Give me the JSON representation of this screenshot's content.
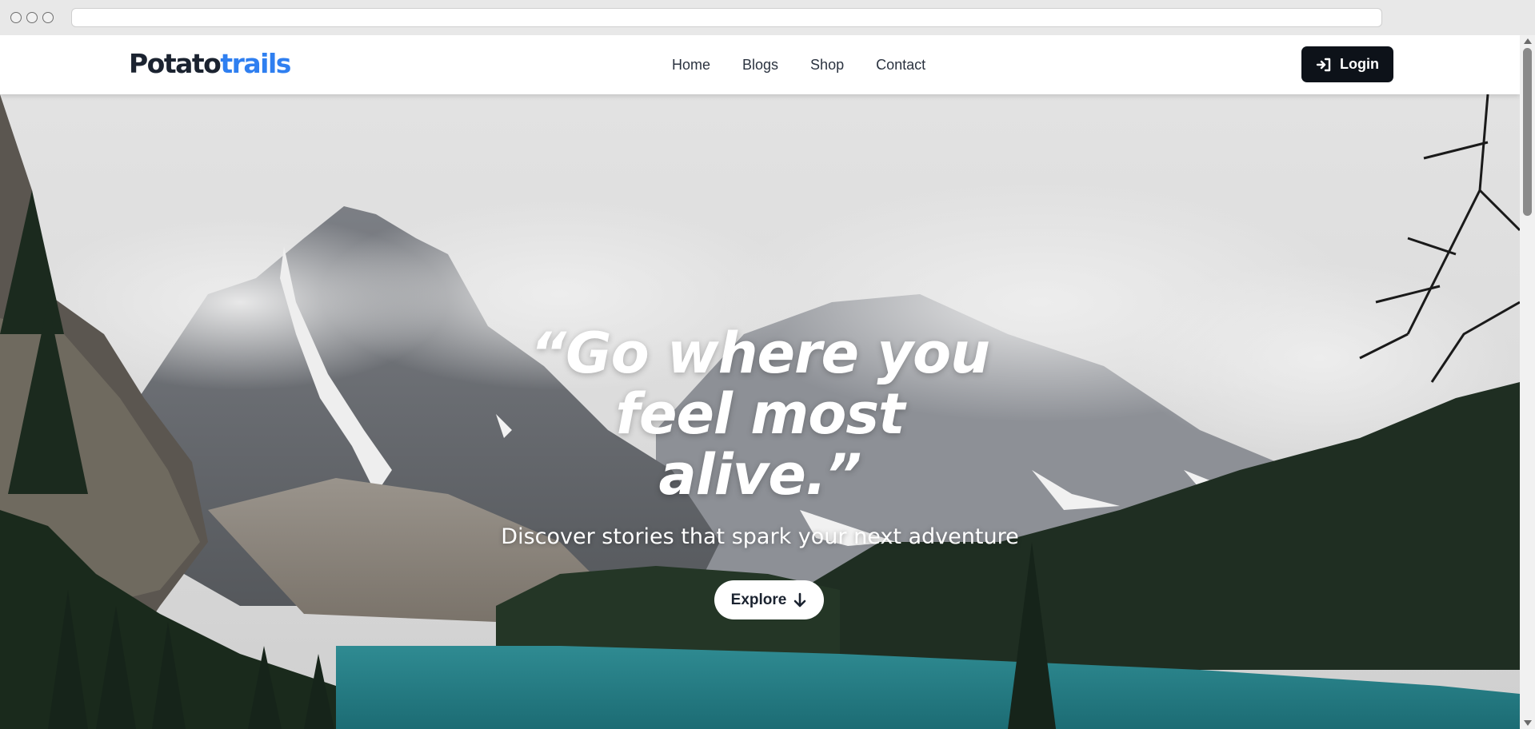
{
  "brand": {
    "logo_part1": "Potato",
    "logo_part2": "trails",
    "logo_color_dark": "#1b2330",
    "logo_color_accent": "#2f7ff0"
  },
  "nav": {
    "items": [
      {
        "label": "Home"
      },
      {
        "label": "Blogs"
      },
      {
        "label": "Shop"
      },
      {
        "label": "Contact"
      }
    ]
  },
  "login": {
    "label": "Login",
    "icon": "login-arrow-icon",
    "background": "#0d1219"
  },
  "hero": {
    "quote": "“Go where you feel most alive.”",
    "subtitle": "Discover stories that spark your next adventure",
    "cta_label": "Explore",
    "cta_icon": "arrow-down-icon"
  }
}
